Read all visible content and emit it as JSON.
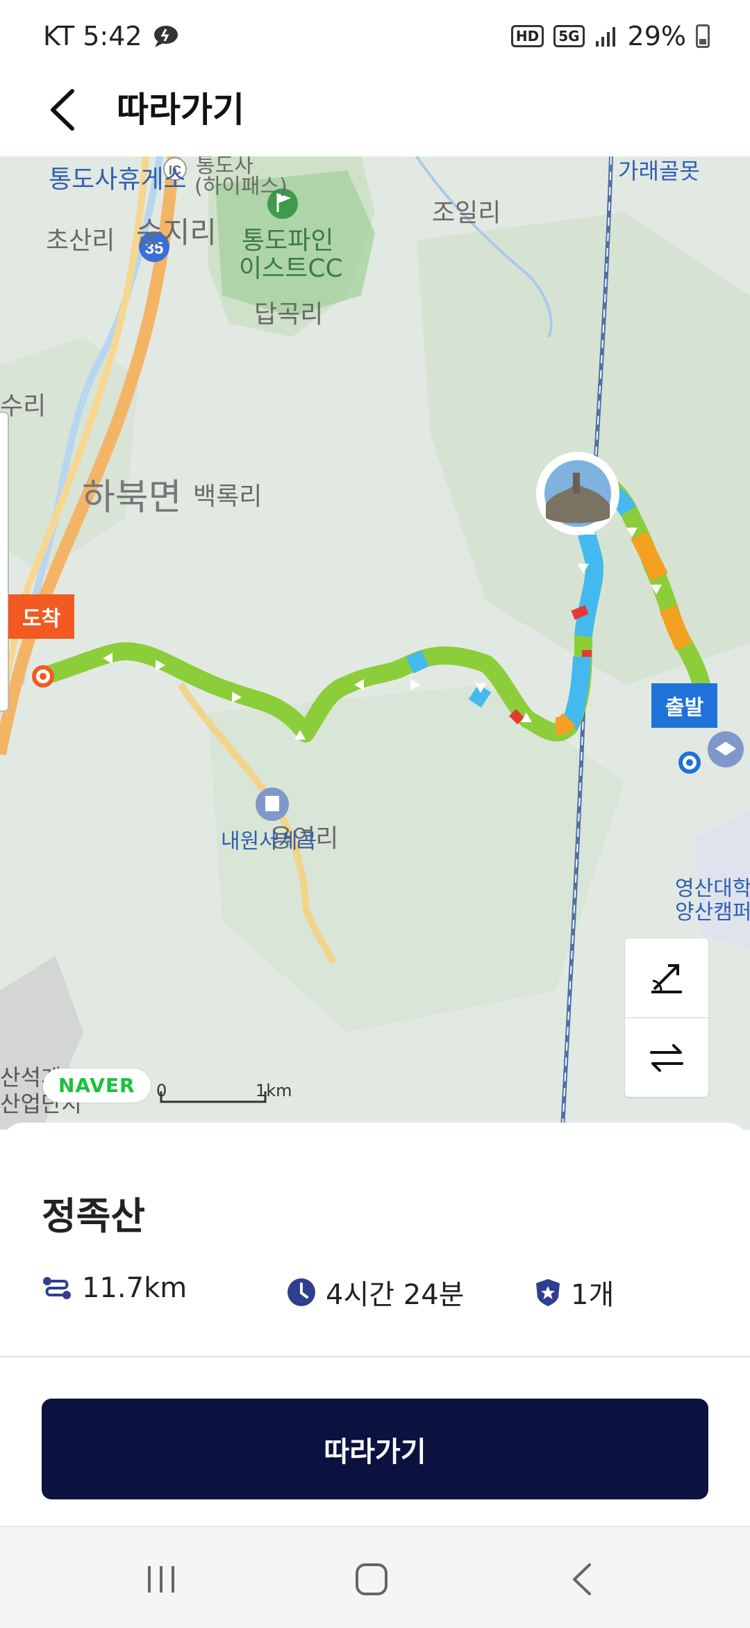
{
  "status_bar": {
    "carrier_time": "KT 5:42",
    "hd_badge": "HD",
    "network_badge": "5G",
    "battery": "29%"
  },
  "app_bar": {
    "title": "따라가기",
    "back_icon": "chevron-left-icon"
  },
  "map": {
    "labels": {
      "rest_area": "통도사휴게소",
      "ic": "IC",
      "tongdosa_line1": "통도사",
      "tongdosa_line2": "(하이패스)",
      "chosanri": "초산리",
      "sujiri": "순지리",
      "route_num": "35",
      "tongdo_pine_line1": "통도파인",
      "tongdo_pine_line2": "이스트CC",
      "joilri": "조일리",
      "dapgokri": "답곡리",
      "garae": "가래골못",
      "suri": "수리",
      "habuk": "하북면",
      "baekrok": "백록리",
      "naewon_valley": "내원사계곡",
      "yongyeonri": "용연리",
      "yeongsan_line1": "영산대학",
      "yeongsan_line2": "양산캠퍼",
      "sanseok_line1": "산석계2",
      "sanseok_line2": "산업단지"
    },
    "end_marker": "도착",
    "start_marker": "출발",
    "naver_logo": "NAVER",
    "scale_start": "0",
    "scale_end": "1km",
    "tools": [
      "slope-icon",
      "swap-icon"
    ]
  },
  "route": {
    "name": "정족산",
    "distance": "11.7km",
    "duration": "4시간 24분",
    "badges": "1개",
    "distance_icon": "route-icon",
    "duration_icon": "clock-icon",
    "badge_icon": "shield-star-icon"
  },
  "cta": {
    "label": "따라가기"
  },
  "nav_bar": {
    "items": [
      "recent-apps-icon",
      "home-icon",
      "back-icon"
    ]
  },
  "colors": {
    "primary_dark": "#0b1240",
    "route_green": "#8ccd3a",
    "route_blue": "#43b9ef",
    "route_orange": "#f4a020",
    "end_orange": "#f25a22",
    "start_blue": "#1f72d8",
    "naver_green": "#18c23a"
  }
}
